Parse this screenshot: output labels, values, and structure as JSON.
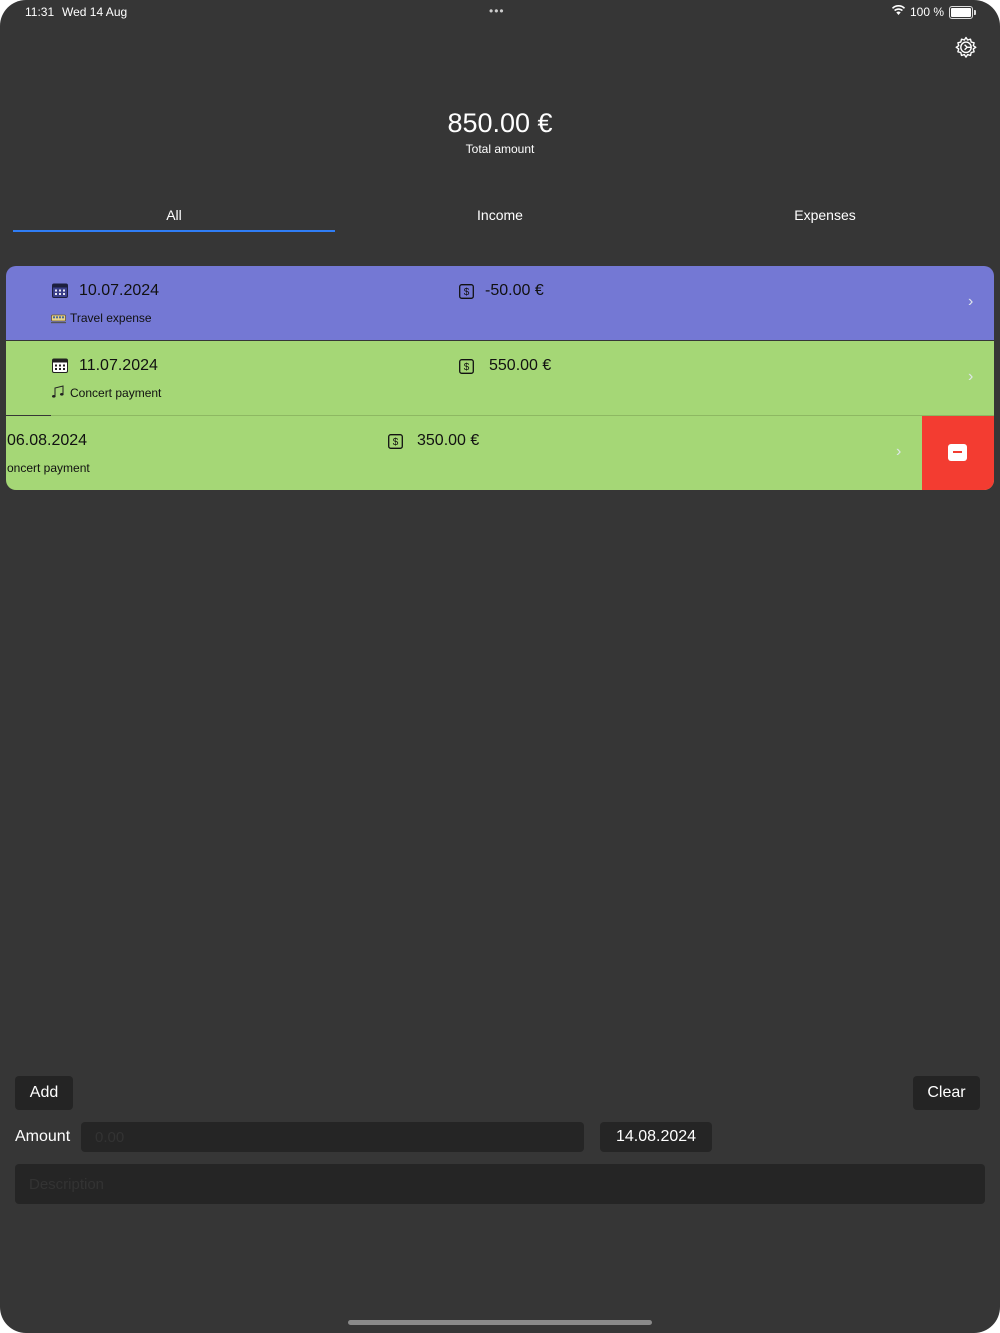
{
  "status_bar": {
    "time": "11:31",
    "date": "Wed 14 Aug",
    "multitask_dots": "•••",
    "battery_percent": "100 %",
    "battery_level": 1.0
  },
  "header": {
    "total_amount": "850.00 €",
    "total_label": "Total amount",
    "settings_icon": "gear-icon"
  },
  "tabs": [
    {
      "label": "All",
      "selected": true
    },
    {
      "label": "Income",
      "selected": false
    },
    {
      "label": "Expenses",
      "selected": false
    }
  ],
  "colors": {
    "background": "#363636",
    "expense_row": "#7478d4",
    "income_row": "#a5d776",
    "delete_action": "#f33c31",
    "tab_accent": "#2f7df5",
    "field_background": "#252525"
  },
  "transactions": [
    {
      "date": "10.07.2024",
      "amount": "-50.00 €",
      "description": "Travel expense",
      "category_icon": "train-icon",
      "type": "expense"
    },
    {
      "date": "11.07.2024",
      "amount": "550.00 €",
      "description": "Concert payment",
      "category_icon": "music-notes-icon",
      "type": "income"
    },
    {
      "date": "06.08.2024",
      "amount": "350.00 €",
      "description": "oncert payment",
      "type": "income",
      "swiped_for_delete": true
    }
  ],
  "form": {
    "add_label": "Add",
    "clear_label": "Clear",
    "amount_label": "Amount",
    "amount_placeholder": "0.00",
    "date_value": "14.08.2024",
    "description_placeholder": "Description"
  }
}
